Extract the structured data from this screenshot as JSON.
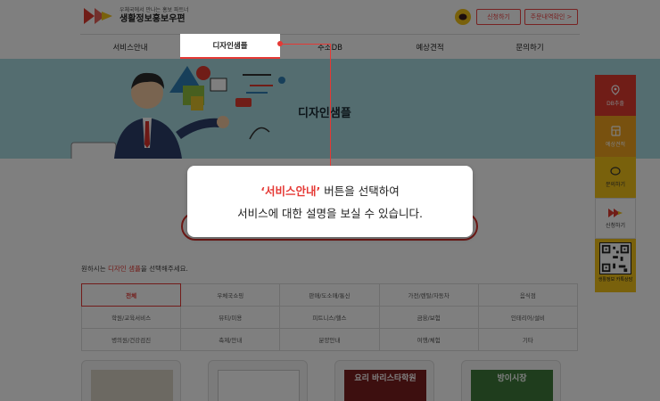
{
  "header": {
    "logo_sub": "우체국에서 만나는 홍보 파트너",
    "logo_main": "생활정보홍보우편",
    "apply_btn": "신청하기",
    "order_btn": "주문내역확인 >"
  },
  "nav": {
    "items": [
      "서비스안내",
      "디자인샘플",
      "주소DB",
      "예상견적",
      "문의하기"
    ],
    "active_index": 1
  },
  "hero": {
    "title": "디자인샘플"
  },
  "intro": {
    "prefix": "원하시는 ",
    "highlight": "디자인 샘플",
    "suffix": "을 선택해주세요."
  },
  "categories": {
    "rows": [
      [
        "전체",
        "우체국쇼핑",
        "판매/도소매/통신",
        "가전/렌탈/자동차",
        "음식점"
      ],
      [
        "학원/교육서비스",
        "뷰티/미용",
        "피트니스/헬스",
        "금융/보험",
        "인테리어/설비"
      ],
      [
        "병의원/건강검진",
        "축제/안내",
        "분양안내",
        "여행/체험",
        "기타"
      ]
    ],
    "active": "전체"
  },
  "cards": [
    {
      "text": ""
    },
    {
      "text": ""
    },
    {
      "text": "요리 바리스타학원"
    },
    {
      "text": "방이시장"
    }
  ],
  "sidebar": {
    "items": [
      "DB추출",
      "예상견적",
      "문의하기",
      "신청하기"
    ],
    "qr_label": "생활정보 카톡상담"
  },
  "tooltip": {
    "quote_open": "‘",
    "highlight": "서비스안내",
    "quote_close": "’",
    "line1_rest": " 버튼을 선택하여",
    "line2": "서비스에 대한 설명을 보실 수 있습니다."
  },
  "colors": {
    "accent": "#e53935",
    "sidebar_red": "#e03a2f",
    "sidebar_orange": "#f0a21f",
    "sidebar_yellow": "#f2c318",
    "hero_bg": "#a9dbe0"
  }
}
